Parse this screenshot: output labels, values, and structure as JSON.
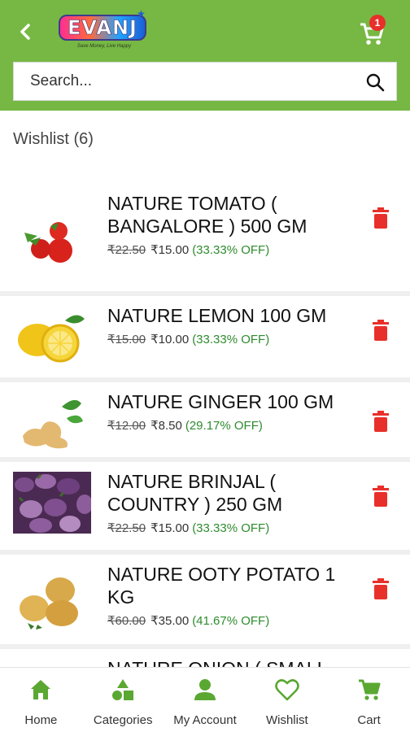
{
  "header": {
    "logo_text": "EVANJ",
    "logo_tagline": "Save Money, Live Happy",
    "cart_badge": "1",
    "back_icon": "chevron-left-icon",
    "cart_icon": "cart-icon",
    "color": "#77b844"
  },
  "search": {
    "placeholder": "Search..."
  },
  "wishlist": {
    "title": "Wishlist (6)"
  },
  "items": [
    {
      "name": "NATURE TOMATO ( BANGALORE ) 500 GM",
      "mrp": "₹22.50",
      "price": "₹15.00",
      "discount": "(33.33% OFF)"
    },
    {
      "name": "NATURE LEMON 100 GM",
      "mrp": "₹15.00",
      "price": "₹10.00",
      "discount": "(33.33% OFF)"
    },
    {
      "name": "NATURE GINGER 100 GM",
      "mrp": "₹12.00",
      "price": "₹8.50",
      "discount": "(29.17% OFF)"
    },
    {
      "name": "NATURE BRINJAL ( COUNTRY ) 250 GM",
      "mrp": "₹22.50",
      "price": "₹15.00",
      "discount": "(33.33% OFF)"
    },
    {
      "name": "NATURE OOTY POTATO 1 KG",
      "mrp": "₹60.00",
      "price": "₹35.00",
      "discount": "(41.67% OFF)"
    },
    {
      "name": "NATURE ONION ( SMALL",
      "mrp": "",
      "price": "",
      "discount": ""
    }
  ],
  "nav": {
    "home": "Home",
    "categories": "Categories",
    "account": "My Account",
    "wishlist": "Wishlist",
    "cart": "Cart"
  },
  "colors": {
    "accent": "#77b844",
    "delete": "#e8302a",
    "discount": "#2e8b2e"
  }
}
